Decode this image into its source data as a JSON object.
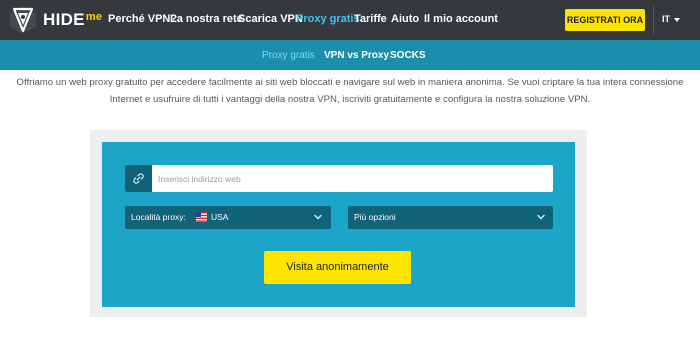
{
  "brand": {
    "name": "HIDE",
    "suffix": "me",
    "logo_icon": "hideme-shield-icon"
  },
  "nav": {
    "items": [
      {
        "label": "Perché VPN?"
      },
      {
        "label": "La nostra rete"
      },
      {
        "label": "Scarica VPN"
      },
      {
        "label": "Proxy gratis",
        "active": true
      },
      {
        "label": "Tariffe"
      },
      {
        "label": "Aiuto"
      },
      {
        "label": "Il mio account"
      }
    ],
    "register_label": "REGISTRATI ORA",
    "language": "IT"
  },
  "subnav": {
    "items": [
      {
        "label": "Proxy gratis",
        "active": true
      },
      {
        "label": "VPN vs Proxy"
      },
      {
        "label": "SOCKS"
      }
    ]
  },
  "intro": {
    "line1": "Offriamo un web proxy gratuito per accedere facilmente ai siti web bloccati e navigare sul web in maniera anonima. Se vuoi criptare la tua intera connessione",
    "line2": "Internet e usufruire di tutti i vantaggi della nostra VPN, iscriviti gratuitamente e configura la nostra soluzione VPN."
  },
  "proxy_form": {
    "url_placeholder": "Inserisci indirizzo web",
    "url_value": "",
    "location_label": "Località proxy:",
    "location_value": "USA",
    "location_flag": "us-flag-icon",
    "options_label": "Più opzioni",
    "submit_label": "Visita anonimamente"
  },
  "colors": {
    "topbar": "#35393d",
    "subbar": "#1a8eaa",
    "panel": "#1ba6c9",
    "dark_control": "#11637a",
    "accent_yellow": "#ffe400",
    "active_link": "#3ec4ee"
  }
}
